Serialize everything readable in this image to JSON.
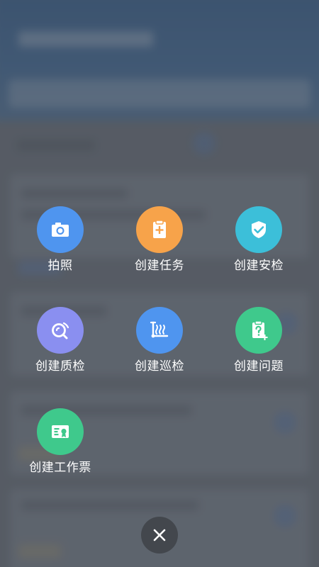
{
  "actions": [
    {
      "id": "photo",
      "label": "拍照",
      "icon": "camera-icon",
      "color": "#4f95ef"
    },
    {
      "id": "create-task",
      "label": "创建任务",
      "icon": "clipboard-plus-icon",
      "color": "#f7a34a"
    },
    {
      "id": "create-safety-check",
      "label": "创建安检",
      "icon": "shield-check-icon",
      "color": "#3cbfd9"
    },
    {
      "id": "create-quality-check",
      "label": "创建质检",
      "icon": "magnifier-scan-icon",
      "color": "#8a8ff0"
    },
    {
      "id": "create-patrol-check",
      "label": "创建巡检",
      "icon": "patrol-route-icon",
      "color": "#4f95ef"
    },
    {
      "id": "create-issue",
      "label": "创建问题",
      "icon": "question-document-icon",
      "color": "#3fc98c"
    },
    {
      "id": "create-work-ticket",
      "label": "创建工作票",
      "icon": "ticket-certificate-icon",
      "color": "#3fc98c"
    }
  ],
  "close": {
    "icon": "close-icon"
  }
}
